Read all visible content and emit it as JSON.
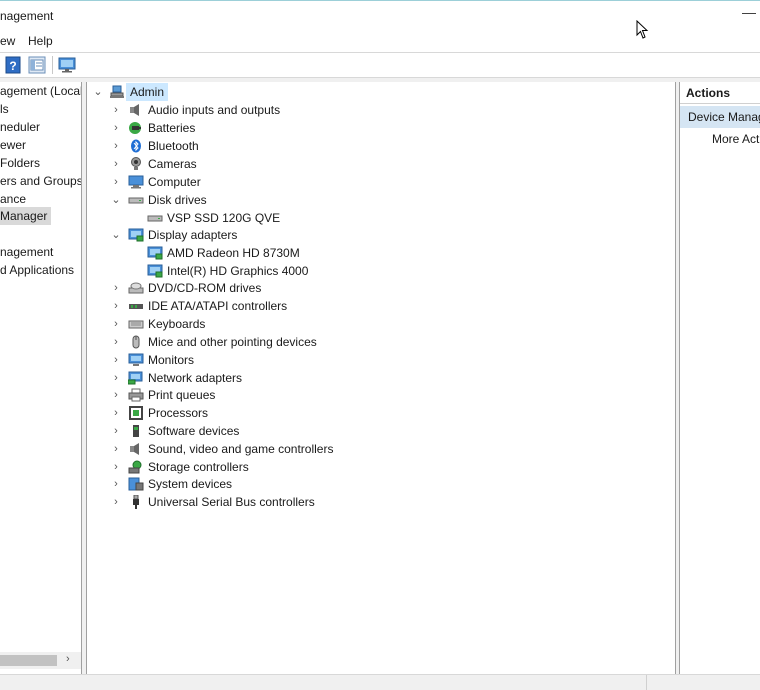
{
  "window": {
    "title": "nagement",
    "minimize_glyph": "—"
  },
  "menu": {
    "items": [
      "ew",
      "Help"
    ]
  },
  "toolbar": {
    "icons": [
      "help-icon",
      "properties-icon",
      "monitor-icon"
    ]
  },
  "left_pane": {
    "items": [
      {
        "label": "agement (Local"
      },
      {
        "label": "ls"
      },
      {
        "label": "neduler"
      },
      {
        "label": "ewer"
      },
      {
        "label": "Folders"
      },
      {
        "label": "ers and Groups"
      },
      {
        "label": "ance"
      },
      {
        "label": "Manager",
        "selected": true
      },
      {
        "label": ""
      },
      {
        "label": "nagement"
      },
      {
        "label": "d Applications"
      }
    ],
    "scroll_right_glyph": "›"
  },
  "tree": {
    "root": {
      "label": "Admin",
      "expander": "⌄"
    },
    "nodes": [
      {
        "label": "Audio inputs and outputs",
        "icon": "speaker-icon",
        "level": 1,
        "expander": "›"
      },
      {
        "label": "Batteries",
        "icon": "battery-icon",
        "level": 1,
        "expander": "›"
      },
      {
        "label": "Bluetooth",
        "icon": "bluetooth-icon",
        "level": 1,
        "expander": "›"
      },
      {
        "label": "Cameras",
        "icon": "camera-icon",
        "level": 1,
        "expander": "›"
      },
      {
        "label": "Computer",
        "icon": "computer-icon",
        "level": 1,
        "expander": "›"
      },
      {
        "label": "Disk drives",
        "icon": "disk-drive-icon",
        "level": 1,
        "expander": "⌄"
      },
      {
        "label": "VSP SSD 120G QVE",
        "icon": "disk-drive-icon",
        "level": 2,
        "expander": ""
      },
      {
        "label": "Display adapters",
        "icon": "display-adapter-icon",
        "level": 1,
        "expander": "⌄"
      },
      {
        "label": "AMD Radeon HD 8730M",
        "icon": "display-adapter-icon",
        "level": 2,
        "expander": ""
      },
      {
        "label": "Intel(R) HD Graphics 4000",
        "icon": "display-adapter-icon",
        "level": 2,
        "expander": ""
      },
      {
        "label": "DVD/CD-ROM drives",
        "icon": "dvd-icon",
        "level": 1,
        "expander": "›"
      },
      {
        "label": "IDE ATA/ATAPI controllers",
        "icon": "ide-controller-icon",
        "level": 1,
        "expander": "›"
      },
      {
        "label": "Keyboards",
        "icon": "keyboard-icon",
        "level": 1,
        "expander": "›"
      },
      {
        "label": "Mice and other pointing devices",
        "icon": "mouse-icon",
        "level": 1,
        "expander": "›"
      },
      {
        "label": "Monitors",
        "icon": "monitor-icon",
        "level": 1,
        "expander": "›"
      },
      {
        "label": "Network adapters",
        "icon": "network-adapter-icon",
        "level": 1,
        "expander": "›"
      },
      {
        "label": "Print queues",
        "icon": "printer-icon",
        "level": 1,
        "expander": "›"
      },
      {
        "label": "Processors",
        "icon": "processor-icon",
        "level": 1,
        "expander": "›"
      },
      {
        "label": "Software devices",
        "icon": "software-device-icon",
        "level": 1,
        "expander": "›"
      },
      {
        "label": "Sound, video and game controllers",
        "icon": "speaker-icon",
        "level": 1,
        "expander": "›"
      },
      {
        "label": "Storage controllers",
        "icon": "storage-controller-icon",
        "level": 1,
        "expander": "›"
      },
      {
        "label": "System devices",
        "icon": "system-device-icon",
        "level": 1,
        "expander": "›"
      },
      {
        "label": "Universal Serial Bus controllers",
        "icon": "usb-icon",
        "level": 1,
        "expander": "›"
      }
    ]
  },
  "actions": {
    "header": "Actions",
    "section": "Device Manager",
    "link": "More Actions"
  },
  "colors": {
    "selection": "#cce8ff",
    "actions_section": "#d5e5f3",
    "icon_blue": "#2a7fd0",
    "icon_green": "#3aa845"
  }
}
